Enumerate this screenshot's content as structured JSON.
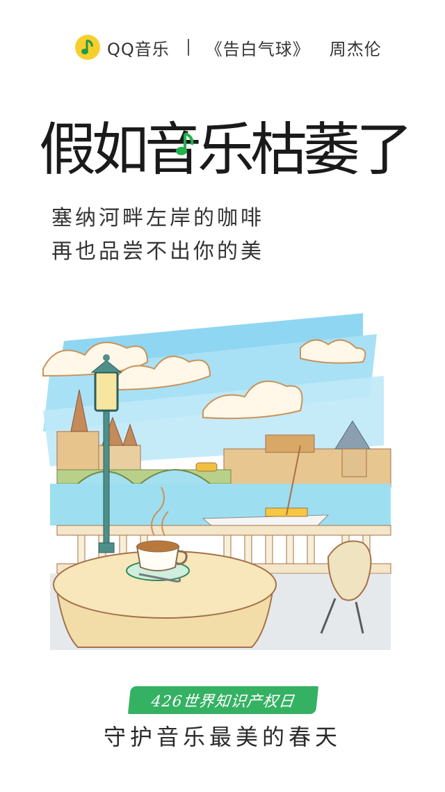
{
  "header": {
    "brand": "QQ音乐",
    "song": "《告白气球》",
    "artist": "周杰伦"
  },
  "title": "假如音乐枯萎了",
  "lyrics": {
    "line1": "塞纳河畔左岸的咖啡",
    "line2": "再也品尝不出你的美"
  },
  "badge": "426世界知识产权日",
  "slogan": "守护音乐最美的春天",
  "colors": {
    "brand_yellow": "#f7cf2c",
    "brand_green": "#35b163",
    "sky": "#7fd0f0",
    "water": "#8fdcf0"
  },
  "icons": [
    "qq-music-logo-icon",
    "music-note-icon",
    "coffee-cup-icon",
    "street-lamp-icon"
  ]
}
